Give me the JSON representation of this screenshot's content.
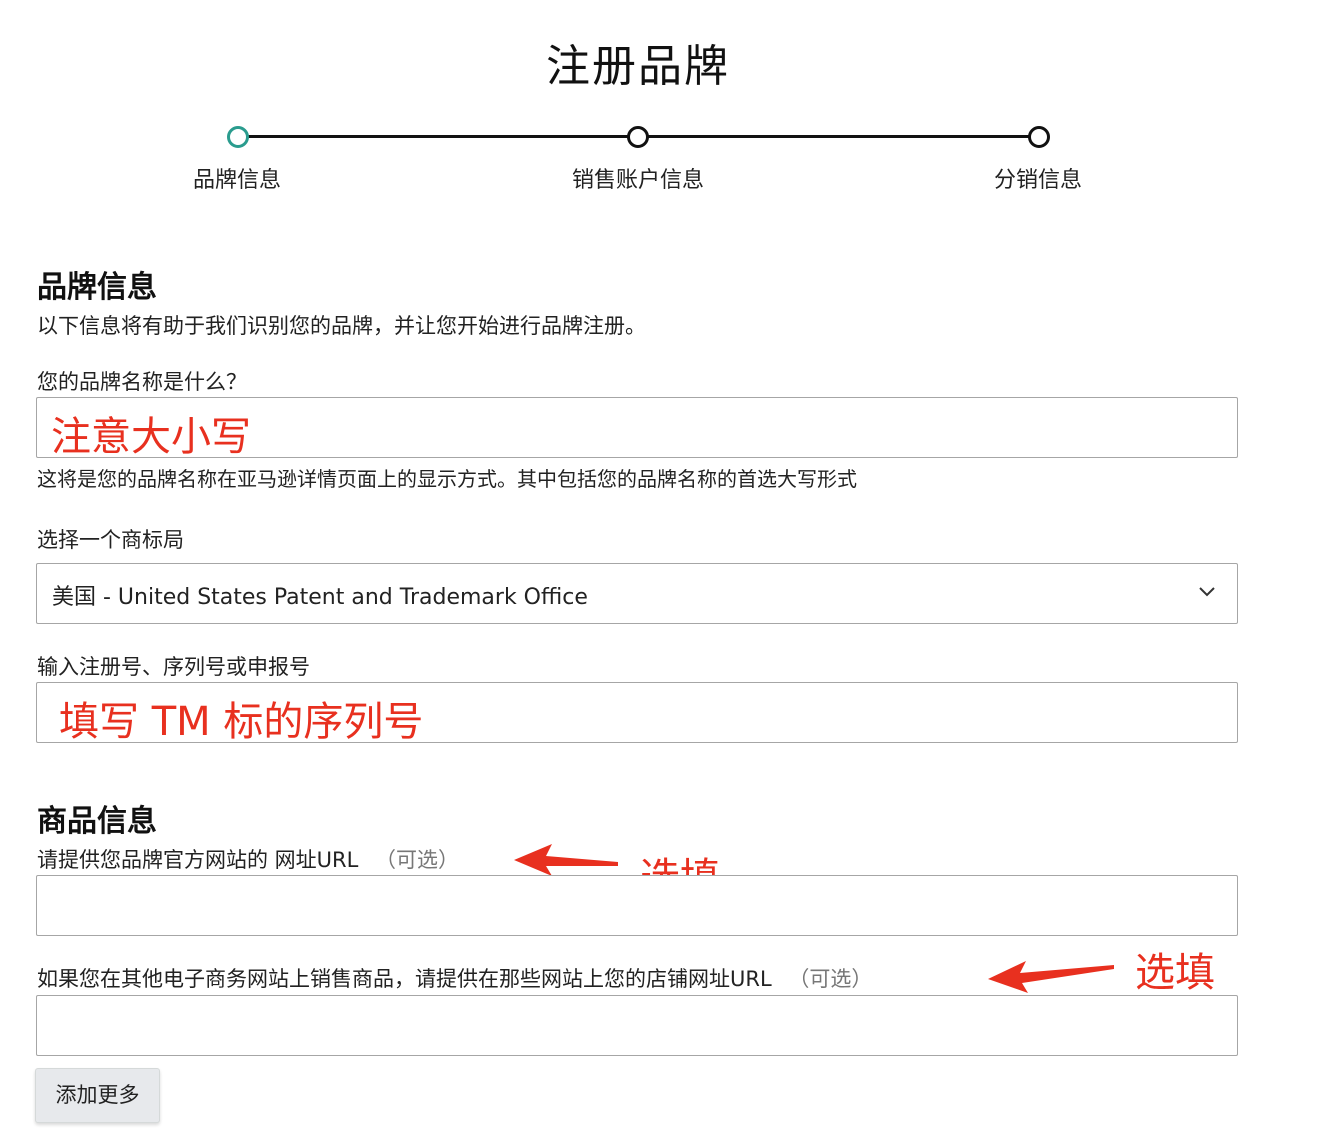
{
  "page": {
    "title": "注册品牌"
  },
  "steps": [
    {
      "label": "品牌信息",
      "active": true
    },
    {
      "label": "销售账户信息",
      "active": false
    },
    {
      "label": "分销信息",
      "active": false
    }
  ],
  "brand_section": {
    "title": "品牌信息",
    "description": "以下信息将有助于我们识别您的品牌，并让您开始进行品牌注册。",
    "brand_name": {
      "label": "您的品牌名称是什么？",
      "annotation": "注意大小写",
      "help": "这将是您的品牌名称在亚马逊详情页面上的显示方式。其中包括您的品牌名称的首选大写形式"
    },
    "trademark_office": {
      "label": "选择一个商标局",
      "selected": "美国 - United States Patent and Trademark Office"
    },
    "registration_number": {
      "label": "输入注册号、序列号或申报号",
      "annotation": "填写 TM 标的序列号"
    }
  },
  "product_section": {
    "title": "商品信息",
    "website_url": {
      "label": "请提供您品牌官方网站的 网址URL",
      "optional": "（可选）",
      "annotation": "选填"
    },
    "store_url": {
      "label": "如果您在其他电子商务网站上销售商品，请提供在那些网站上您的店铺网址URL",
      "optional": "（可选）",
      "annotation": "选填"
    },
    "add_more": "添加更多"
  },
  "colors": {
    "active_step": "#2a9c8e",
    "annotation_red": "#e8301f",
    "field_border": "#a6a6a6"
  },
  "icons": [
    "chevron-down-icon",
    "red-arrow-icon"
  ]
}
